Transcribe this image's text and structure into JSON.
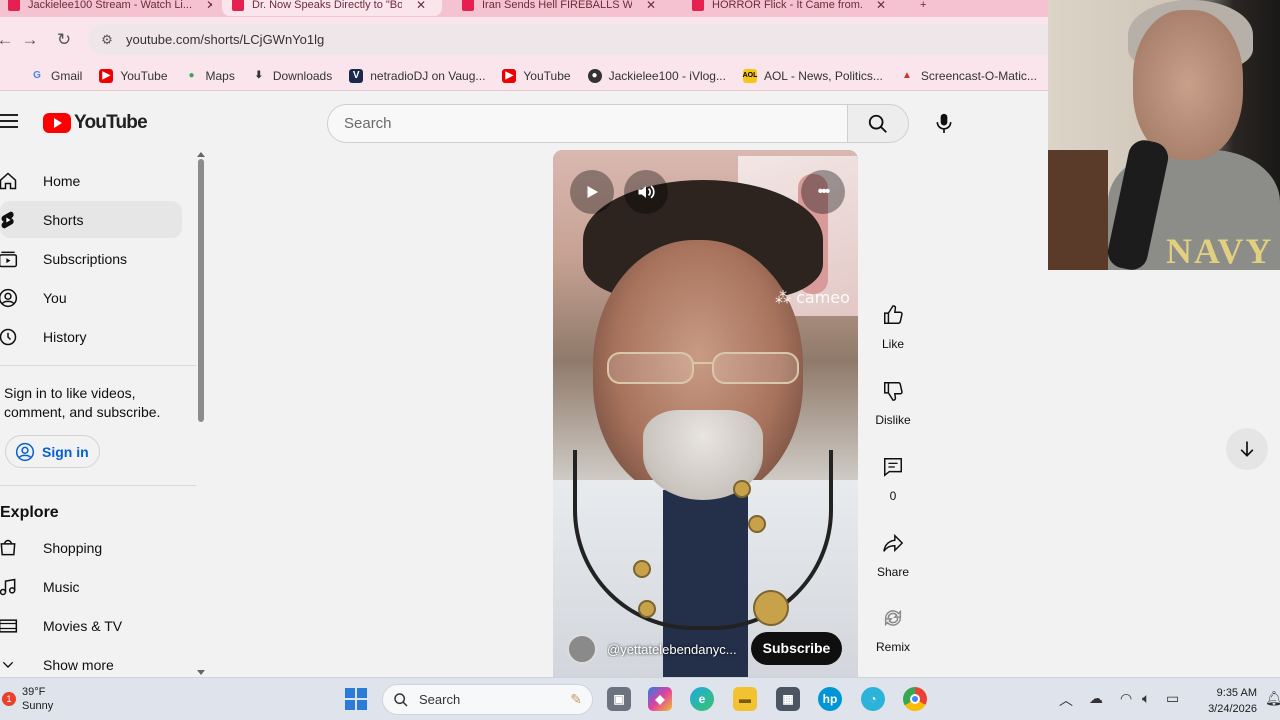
{
  "browser": {
    "tabs": [
      {
        "title": "Jackielee100 Stream - Watch Li...",
        "active": false
      },
      {
        "title": "Dr. Now Speaks Directly to \"Bo...",
        "active": true
      },
      {
        "title": "Iran Sends Hell FIREBALLS Wit...",
        "active": false
      },
      {
        "title": "HORROR Flick - It Came from...",
        "active": false
      }
    ],
    "url": "youtube.com/shorts/LCjGWnYo1lg",
    "bookmarks": [
      "Gmail",
      "YouTube",
      "Maps",
      "Downloads",
      "netradioDJ on Vaug...",
      "YouTube",
      "Jackielee100 - iVlog...",
      "AOL - News, Politics...",
      "Screencast-O-Matic..."
    ]
  },
  "youtube": {
    "logo": "YouTube",
    "search_placeholder": "Search",
    "sidebar": {
      "items": [
        {
          "label": "Home",
          "icon": "home-icon",
          "selected": false
        },
        {
          "label": "Shorts",
          "icon": "shorts-icon",
          "selected": true
        },
        {
          "label": "Subscriptions",
          "icon": "subscriptions-icon",
          "selected": false
        },
        {
          "label": "You",
          "icon": "person-icon",
          "selected": false
        },
        {
          "label": "History",
          "icon": "history-icon",
          "selected": false
        }
      ],
      "signin_prompt": "Sign in to like videos, comment, and subscribe.",
      "signin_label": "Sign in",
      "explore_heading": "Explore",
      "explore_items": [
        {
          "label": "Shopping",
          "icon": "shopping-icon"
        },
        {
          "label": "Music",
          "icon": "music-icon"
        },
        {
          "label": "Movies & TV",
          "icon": "film-icon"
        },
        {
          "label": "Show more",
          "icon": "chevron-down-icon"
        }
      ]
    },
    "short": {
      "watermark": "cameo",
      "channel": "@yettatelebendanyc...",
      "subscribe_label": "Subscribe"
    },
    "actions": [
      {
        "label": "Like",
        "icon": "thumbs-up-icon"
      },
      {
        "label": "Dislike",
        "icon": "thumbs-down-icon"
      },
      {
        "label": "0",
        "icon": "comment-icon"
      },
      {
        "label": "Share",
        "icon": "share-icon"
      },
      {
        "label": "Remix",
        "icon": "remix-icon"
      }
    ]
  },
  "webcam": {
    "shirt_text": "NAVY"
  },
  "taskbar": {
    "weather_temp": "39°F",
    "weather_desc": "Sunny",
    "weather_badge": "1",
    "search_placeholder": "Search",
    "time": "9:35 AM",
    "date": "3/24/2026"
  }
}
